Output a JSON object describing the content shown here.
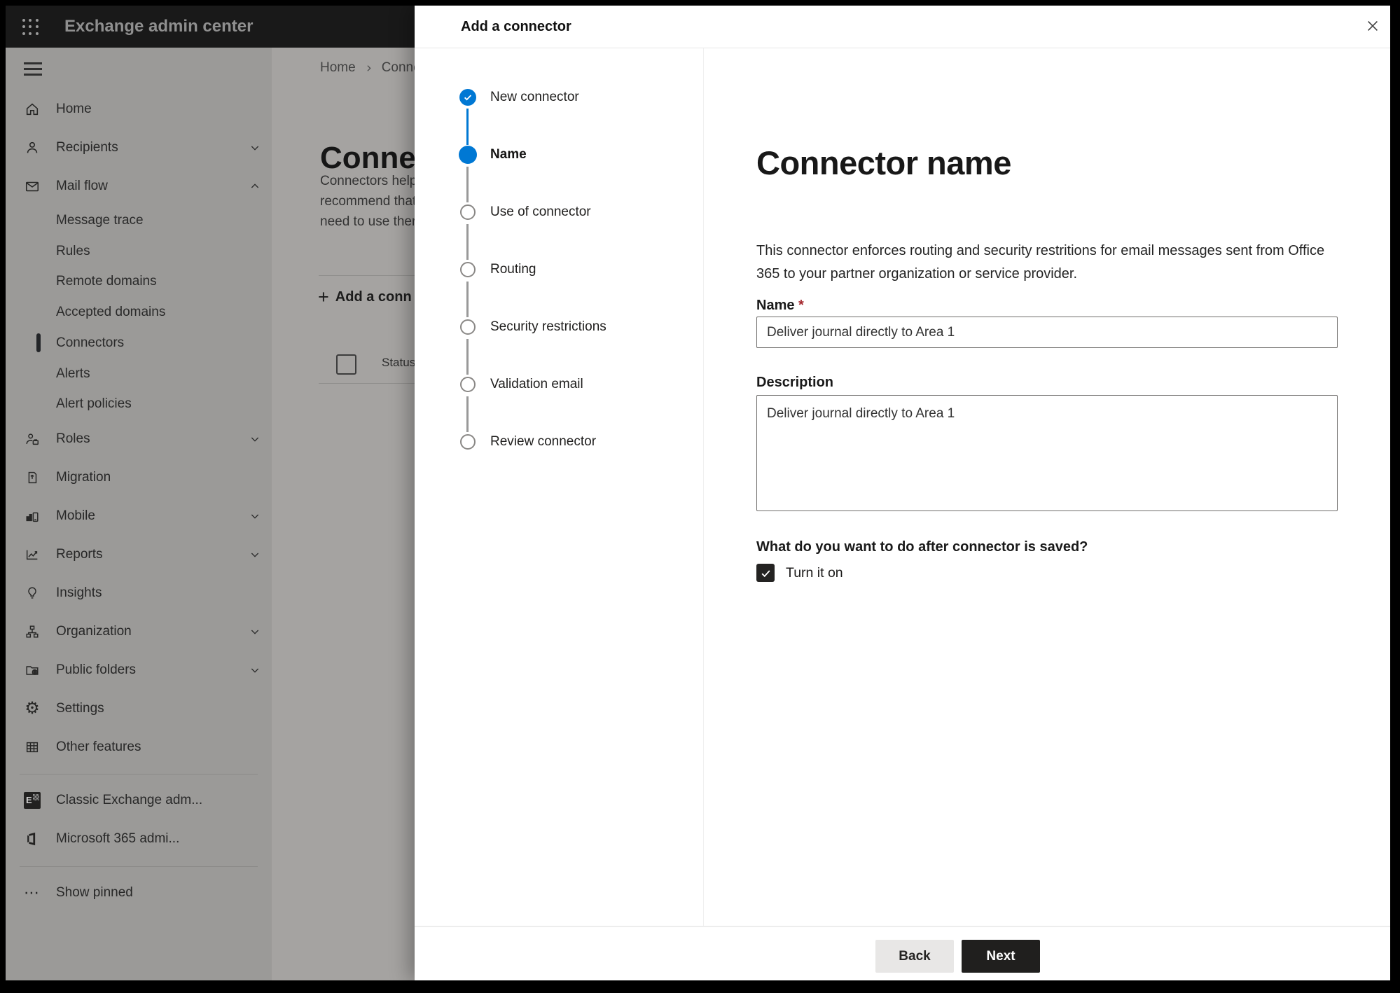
{
  "app": {
    "title": "Exchange admin center"
  },
  "sidebar": {
    "items": [
      {
        "label": "Home"
      },
      {
        "label": "Recipients",
        "chevron": "down"
      },
      {
        "label": "Mail flow",
        "chevron": "up"
      },
      {
        "label": "Message trace",
        "sub": true
      },
      {
        "label": "Rules",
        "sub": true
      },
      {
        "label": "Remote domains",
        "sub": true
      },
      {
        "label": "Accepted domains",
        "sub": true
      },
      {
        "label": "Connectors",
        "sub": true,
        "selected": true
      },
      {
        "label": "Alerts",
        "sub": true
      },
      {
        "label": "Alert policies",
        "sub": true
      },
      {
        "label": "Roles",
        "chevron": "down"
      },
      {
        "label": "Migration"
      },
      {
        "label": "Mobile",
        "chevron": "down"
      },
      {
        "label": "Reports",
        "chevron": "down"
      },
      {
        "label": "Insights"
      },
      {
        "label": "Organization",
        "chevron": "down"
      },
      {
        "label": "Public folders",
        "chevron": "down"
      },
      {
        "label": "Settings"
      },
      {
        "label": "Other features"
      },
      {
        "label": "Classic Exchange adm..."
      },
      {
        "label": "Microsoft 365 admi..."
      },
      {
        "label": "Show pinned"
      }
    ]
  },
  "page": {
    "breadcrumb": {
      "home": "Home",
      "current": "Conne"
    },
    "title": "Connec",
    "intro_lines": [
      "Connectors help",
      "recommend that",
      "need to use ther"
    ],
    "add_button_label": "Add a conn",
    "table_header_status": "Status"
  },
  "modal": {
    "title": "Add a connector",
    "steps": [
      {
        "label": "New connector",
        "state": "completed"
      },
      {
        "label": "Name",
        "state": "current"
      },
      {
        "label": "Use of connector",
        "state": "upcoming"
      },
      {
        "label": "Routing",
        "state": "upcoming"
      },
      {
        "label": "Security restrictions",
        "state": "upcoming"
      },
      {
        "label": "Validation email",
        "state": "upcoming"
      },
      {
        "label": "Review connector",
        "state": "upcoming"
      }
    ],
    "content": {
      "heading": "Connector name",
      "description": "This connector enforces routing and security restritions for email messages sent from Office 365 to your partner organization or service provider.",
      "name_label": "Name",
      "required_mark": "*",
      "name_value": "Deliver journal directly to Area 1",
      "description_label": "Description",
      "description_value": "Deliver journal directly to Area 1",
      "after_save_question": "What do you want to do after connector is saved?",
      "turn_on_label": "Turn it on",
      "turn_on_checked": true
    },
    "footer": {
      "back_label": "Back",
      "next_label": "Next"
    }
  },
  "icons": {
    "settings_glyph": "⚙",
    "show_pinned_glyph": "⋯",
    "plus_glyph": "+",
    "classic_exchange_letter": "E"
  },
  "colors": {
    "accent": "#0078d4",
    "topbar_bg": "#191919",
    "dim_sidebar_bg": "#9b9a98",
    "dim_page_bg": "#a5a3a1",
    "modal_bg": "#ffffff",
    "next_button_bg": "#201f1e",
    "back_button_bg": "#e8e7e6",
    "required_red": "#a4262c",
    "checkbox_bg": "#242322"
  }
}
